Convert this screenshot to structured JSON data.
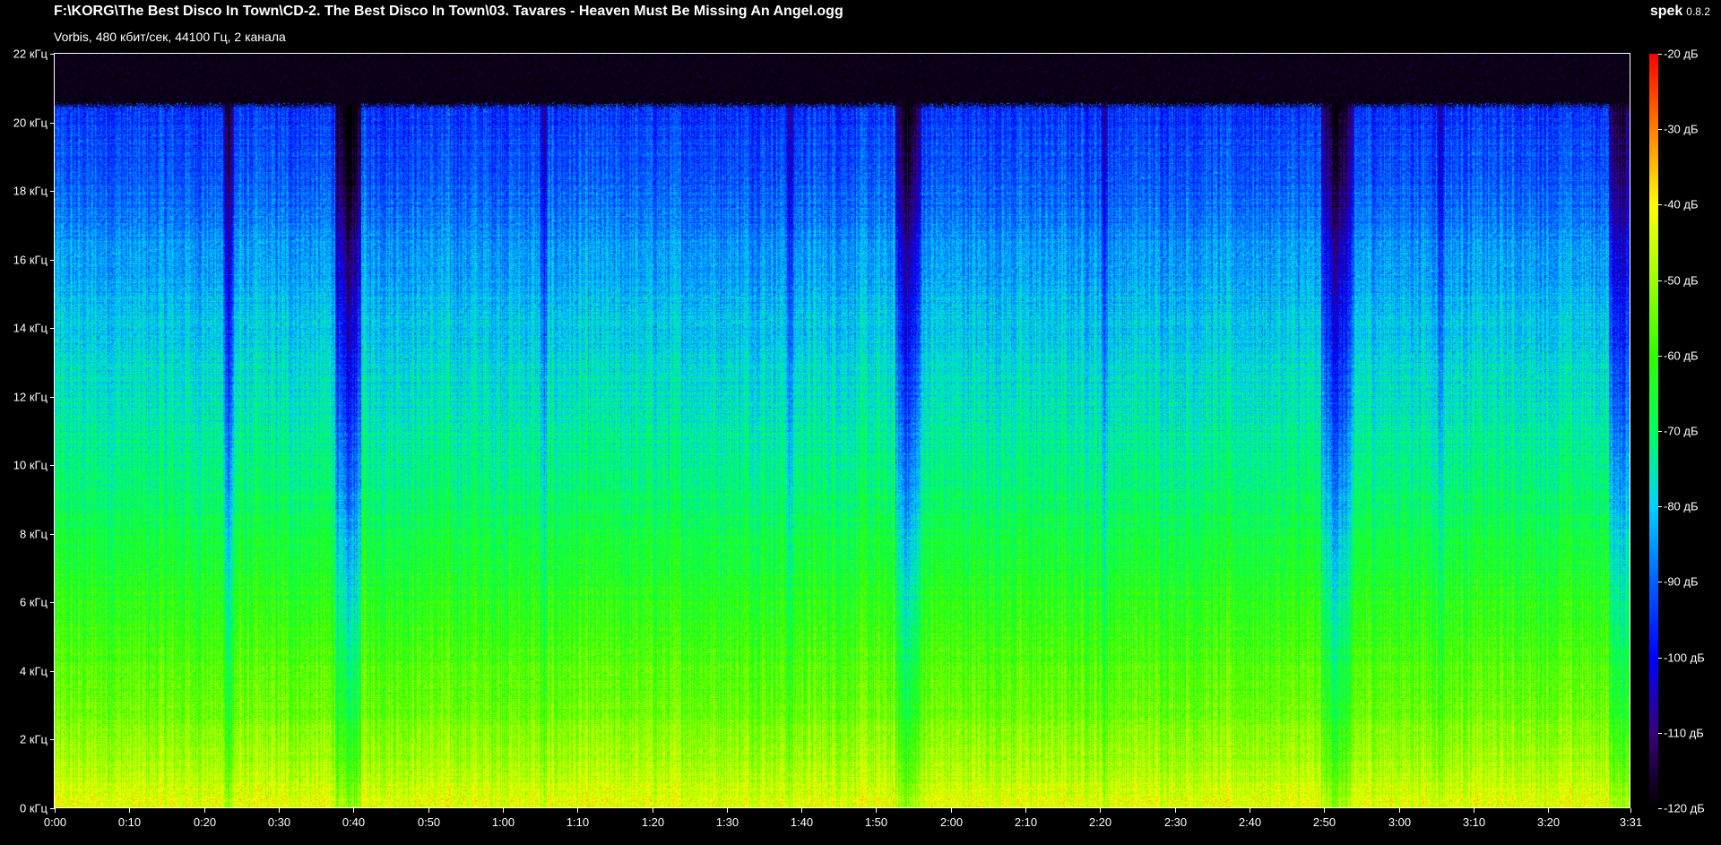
{
  "window": {
    "file_title": "F:\\KORG\\The Best Disco In Town\\CD-2. The Best Disco In Town\\03. Tavares - Heaven Must Be Missing An Angel.ogg",
    "stream_info": "Vorbis, 480 кбит/сек, 44100 Гц, 2 канала",
    "app_name": "spek",
    "app_version": "0.8.2"
  },
  "chart_data": {
    "type": "heatmap",
    "title": "",
    "xlabel": "",
    "ylabel": "",
    "x_unit": "seconds",
    "y_unit": "kHz",
    "color_unit": "dB",
    "xlim": [
      0,
      211
    ],
    "ylim": [
      0,
      22
    ],
    "clim": [
      -120,
      -20
    ],
    "grid": false,
    "x_ticks": [
      {
        "value": 0,
        "label": "0:00"
      },
      {
        "value": 10,
        "label": "0:10"
      },
      {
        "value": 20,
        "label": "0:20"
      },
      {
        "value": 30,
        "label": "0:30"
      },
      {
        "value": 40,
        "label": "0:40"
      },
      {
        "value": 50,
        "label": "0:50"
      },
      {
        "value": 60,
        "label": "1:00"
      },
      {
        "value": 70,
        "label": "1:10"
      },
      {
        "value": 80,
        "label": "1:20"
      },
      {
        "value": 90,
        "label": "1:30"
      },
      {
        "value": 100,
        "label": "1:40"
      },
      {
        "value": 110,
        "label": "1:50"
      },
      {
        "value": 120,
        "label": "2:00"
      },
      {
        "value": 130,
        "label": "2:10"
      },
      {
        "value": 140,
        "label": "2:20"
      },
      {
        "value": 150,
        "label": "2:30"
      },
      {
        "value": 160,
        "label": "2:40"
      },
      {
        "value": 170,
        "label": "2:50"
      },
      {
        "value": 180,
        "label": "3:00"
      },
      {
        "value": 190,
        "label": "3:10"
      },
      {
        "value": 200,
        "label": "3:20"
      },
      {
        "value": 211,
        "label": "3:31"
      }
    ],
    "y_ticks": [
      {
        "value": 0,
        "label": "0 кГц"
      },
      {
        "value": 2,
        "label": "2 кГц"
      },
      {
        "value": 4,
        "label": "4 кГц"
      },
      {
        "value": 6,
        "label": "6 кГц"
      },
      {
        "value": 8,
        "label": "8 кГц"
      },
      {
        "value": 10,
        "label": "10 кГц"
      },
      {
        "value": 12,
        "label": "12 кГц"
      },
      {
        "value": 14,
        "label": "14 кГц"
      },
      {
        "value": 16,
        "label": "16 кГц"
      },
      {
        "value": 18,
        "label": "18 кГц"
      },
      {
        "value": 20,
        "label": "20 кГц"
      },
      {
        "value": 22,
        "label": "22 кГц"
      }
    ],
    "colorbar_ticks": [
      {
        "value": -20,
        "label": "-20 дБ"
      },
      {
        "value": -30,
        "label": "-30 дБ"
      },
      {
        "value": -40,
        "label": "-40 дБ"
      },
      {
        "value": -50,
        "label": "-50 дБ"
      },
      {
        "value": -60,
        "label": "-60 дБ"
      },
      {
        "value": -70,
        "label": "-70 дБ"
      },
      {
        "value": -80,
        "label": "-80 дБ"
      },
      {
        "value": -90,
        "label": "-90 дБ"
      },
      {
        "value": -100,
        "label": "-100 дБ"
      },
      {
        "value": -110,
        "label": "-110 дБ"
      },
      {
        "value": -120,
        "label": "-120 дБ"
      }
    ],
    "colormap": [
      {
        "db": -120,
        "color": "#000000"
      },
      {
        "db": -110,
        "color": "#3a0078"
      },
      {
        "db": -100,
        "color": "#0000ff"
      },
      {
        "db": -90,
        "color": "#0060ff"
      },
      {
        "db": -80,
        "color": "#00d0ff"
      },
      {
        "db": -70,
        "color": "#00ff60"
      },
      {
        "db": -60,
        "color": "#30ff00"
      },
      {
        "db": -50,
        "color": "#a0ff00"
      },
      {
        "db": -40,
        "color": "#ffff00"
      },
      {
        "db": -30,
        "color": "#ff8000"
      },
      {
        "db": -20,
        "color": "#ff0000"
      }
    ],
    "spectrum": {
      "cutoff_khz": 20.5,
      "cutoff_db": -100,
      "background_db": -120,
      "level_points": [
        {
          "khz": 0,
          "db": -42
        },
        {
          "khz": 1,
          "db": -48
        },
        {
          "khz": 3,
          "db": -55
        },
        {
          "khz": 6,
          "db": -62
        },
        {
          "khz": 8,
          "db": -67
        },
        {
          "khz": 10,
          "db": -72
        },
        {
          "khz": 12,
          "db": -76
        },
        {
          "khz": 14,
          "db": -80
        },
        {
          "khz": 16,
          "db": -84
        },
        {
          "khz": 18,
          "db": -90
        },
        {
          "khz": 20.5,
          "db": -95
        }
      ],
      "quiet_segments": [
        {
          "t_start": 22.5,
          "t_end": 24.0,
          "depth_db": 18
        },
        {
          "t_start": 37.5,
          "t_end": 41.0,
          "depth_db": 28
        },
        {
          "t_start": 65.0,
          "t_end": 66.0,
          "depth_db": 12
        },
        {
          "t_start": 98.0,
          "t_end": 99.0,
          "depth_db": 12
        },
        {
          "t_start": 112.5,
          "t_end": 116.0,
          "depth_db": 22
        },
        {
          "t_start": 140.0,
          "t_end": 141.0,
          "depth_db": 10
        },
        {
          "t_start": 169.5,
          "t_end": 174.0,
          "depth_db": 22
        },
        {
          "t_start": 185.0,
          "t_end": 186.0,
          "depth_db": 10
        },
        {
          "t_start": 208.0,
          "t_end": 211.0,
          "depth_db": 20
        }
      ]
    }
  }
}
